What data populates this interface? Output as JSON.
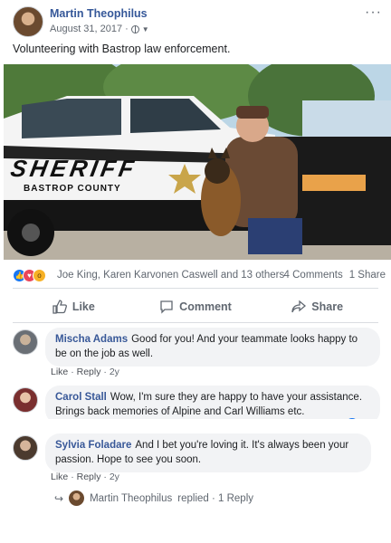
{
  "post": {
    "author": "Martin Theophilus",
    "date": "August 31, 2017",
    "date_sep": "·",
    "privacy_icon": "globe-icon",
    "more_label": "···",
    "status_text": "Volunteering with Bastrop law enforcement.",
    "photo": {
      "car_text_line1": "SHERIFF",
      "car_text_line2": "BASTROP COUNTY"
    }
  },
  "reactions": {
    "icons": [
      "like-icon",
      "love-icon",
      "wow-icon"
    ],
    "names": "Joe King, Karen Karvonen Caswell and 13 others",
    "comments_count": "4 Comments",
    "share_count": "1 Share"
  },
  "actions": {
    "like_label": "Like",
    "comment_label": "Comment",
    "share_label": "Share"
  },
  "comments": [
    {
      "name": "Mischa Adams",
      "text_line1": "Good for you! And your teammate looks happy to",
      "text_line2": "be on the job as well.",
      "like_label": "Like",
      "reply_label": "Reply",
      "sep": "·",
      "age": "2y"
    },
    {
      "name": "Carol Stall",
      "text_line1": "Wow, I'm sure they are happy to have your assistance.",
      "text_line2": "Brings back memories of Alpine and Carl Williams etc."
    },
    {
      "name": "Sylvia Foladare",
      "text_line1": "And I bet you're loving it. It's always been your",
      "text_line2": "passion. Hope to see you soon.",
      "like_label": "Like",
      "reply_label": "Reply",
      "sep": "·",
      "age": "2y"
    }
  ],
  "reply_summary": {
    "name": "Martin Theophilus",
    "text": "replied · 1 Reply"
  },
  "colors": {
    "link_blue": "#365899",
    "meta_gray": "#606770",
    "bubble_bg": "#f2f3f5",
    "like_blue": "#1877f2"
  }
}
